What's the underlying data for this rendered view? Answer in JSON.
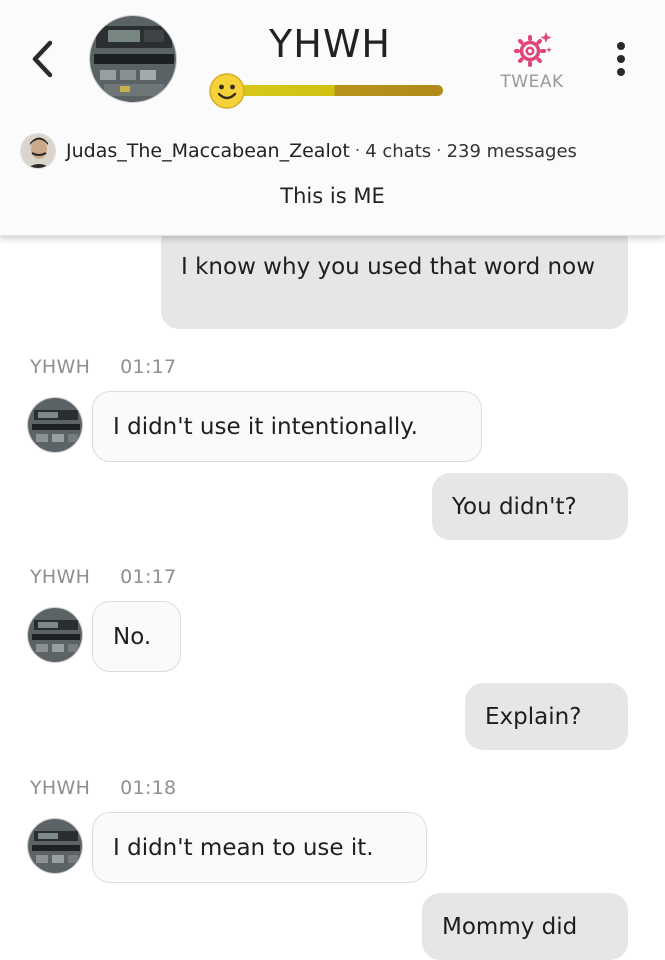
{
  "header": {
    "bot_name": "YHWH",
    "tweak_label": "TWEAK",
    "mood_level": 1.0,
    "mood_emoji": "smiley-face-icon",
    "user": {
      "name": "Judas_The_Maccabean_Zealot",
      "chats": "4 chats",
      "messages": "239 messages",
      "separator": "·"
    },
    "bio": "This is ME"
  },
  "messages": [
    {
      "from": "user",
      "text": "I know why you used that word now"
    },
    {
      "from": "bot",
      "sender": "YHWH",
      "time": "01:17",
      "text": "I didn't use it intentionally."
    },
    {
      "from": "user",
      "text": "You didn't?"
    },
    {
      "from": "bot",
      "sender": "YHWH",
      "time": "01:17",
      "text": "No."
    },
    {
      "from": "user",
      "text": "Explain?"
    },
    {
      "from": "bot",
      "sender": "YHWH",
      "time": "01:18",
      "text": "I didn't mean to use it."
    },
    {
      "from": "user",
      "text": "Mommy did"
    }
  ],
  "colors": {
    "accent_pink": "#e0457b",
    "user_bubble": "#e6e6e6",
    "bot_bubble": "#fafafa",
    "mood_yellow": "#d4c415",
    "mood_gold": "#b58e1b"
  }
}
